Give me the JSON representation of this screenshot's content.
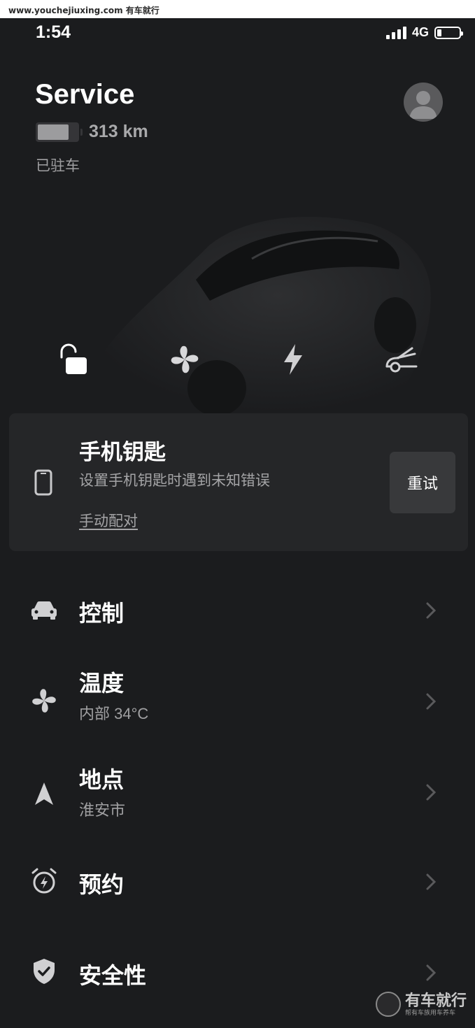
{
  "watermark": {
    "top_text": "www.youchejiuxing.com 有车就行",
    "brand": "有车就行",
    "tagline": "帮有车族用车养车"
  },
  "status_bar": {
    "time": "1:54",
    "network": "4G",
    "battery_level": 0.15
  },
  "header": {
    "title": "Service",
    "range": "313 km",
    "status": "已驻车",
    "car_battery_level": 0.78
  },
  "quick_controls": [
    {
      "name": "lock",
      "icon": "unlock-icon"
    },
    {
      "name": "climate",
      "icon": "fan-icon"
    },
    {
      "name": "charge",
      "icon": "lightning-icon"
    },
    {
      "name": "frunk",
      "icon": "frunk-icon"
    }
  ],
  "phone_key_card": {
    "title": "手机钥匙",
    "message": "设置手机钥匙时遇到未知错误",
    "link": "手动配对",
    "retry_label": "重试",
    "icon": "phone-icon"
  },
  "menu": [
    {
      "title": "控制",
      "subtitle": "",
      "icon": "car-icon"
    },
    {
      "title": "温度",
      "subtitle": "内部 34°C",
      "icon": "fan-icon"
    },
    {
      "title": "地点",
      "subtitle": "淮安市",
      "icon": "navigation-arrow-icon"
    },
    {
      "title": "预约",
      "subtitle": "",
      "icon": "alarm-clock-icon"
    },
    {
      "title": "安全性",
      "subtitle": "",
      "icon": "shield-check-icon"
    }
  ],
  "colors": {
    "background": "#1b1c1e",
    "card": "#252628",
    "button": "#38393b",
    "text_secondary": "#a0a0a2"
  }
}
